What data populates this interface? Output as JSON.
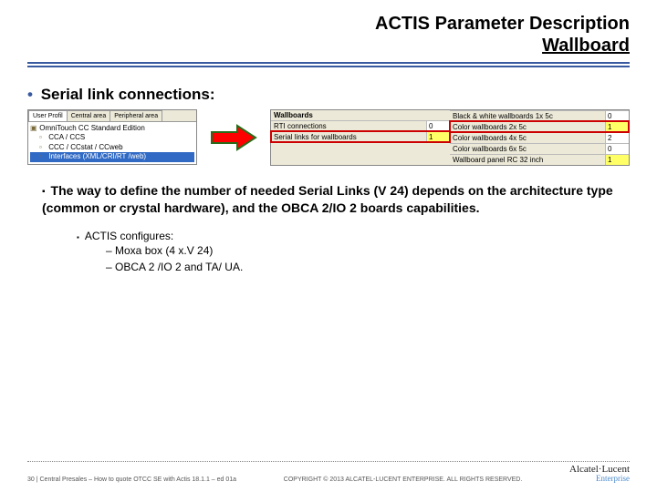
{
  "header": {
    "title_line1": "ACTIS Parameter Description",
    "title_line2": "Wallboard"
  },
  "main_bullet": "Serial link connections:",
  "tree_panel": {
    "tabs": [
      "User Profil",
      "Central area",
      "Peripheral area"
    ],
    "active_tab": 0,
    "items": [
      "OmniTouch CC Standard Edition",
      "CCA / CCS",
      "CCC / CCstat / CCweb",
      "Interfaces (XML/CRI/RT /web)"
    ],
    "selected_index": 3
  },
  "params_panel": {
    "section_head": "Wallboards",
    "left_rows": [
      {
        "label": "RTI connections",
        "value": "0",
        "hl": false
      },
      {
        "label": "Serial links for wallboards",
        "value": "1",
        "hl": true
      }
    ],
    "right_rows": [
      {
        "label": "Black & white wallboards 1x 5c",
        "value": "0",
        "hl": false
      },
      {
        "label": "Color wallboards 2x 5c",
        "value": "1",
        "hl": true
      },
      {
        "label": "Color wallboards 4x 5c",
        "value": "2",
        "hl": false
      },
      {
        "label": "Color wallboards 6x 5c",
        "value": "0",
        "hl": false
      },
      {
        "label": "Wallboard panel RC 32 inch",
        "value": "1",
        "hl": false
      }
    ]
  },
  "explain": {
    "main": "The way to define the number of needed Serial Links (V 24) depends on the architecture type (common or crystal hardware), and the OBCA 2/IO 2 boards capabilities.",
    "sub_head": "ACTIS configures:",
    "dashes": [
      "Moxa box (4 x.V 24)",
      "OBCA 2 /IO 2 and TA/ UA."
    ]
  },
  "footer": {
    "left": "30 | Central Presales – How to quote OTCC SE with Actis 18.1.1 – ed 01a",
    "center": "COPYRIGHT © 2013 ALCATEL-LUCENT ENTERPRISE. ALL RIGHTS RESERVED.",
    "logo_line1": "Alcatel·Lucent",
    "logo_line2": "Enterprise"
  }
}
